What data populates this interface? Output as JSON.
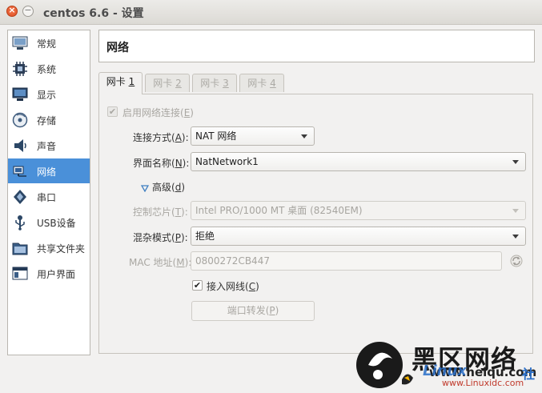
{
  "window": {
    "title": "centos 6.6 - 设置",
    "close_glyph": "×",
    "min_glyph": "−"
  },
  "sidebar": {
    "items": [
      {
        "label": "常规",
        "icon": "general-icon"
      },
      {
        "label": "系统",
        "icon": "chip-icon"
      },
      {
        "label": "显示",
        "icon": "monitor-icon"
      },
      {
        "label": "存储",
        "icon": "disk-icon"
      },
      {
        "label": "声音",
        "icon": "speaker-icon"
      },
      {
        "label": "网络",
        "icon": "network-icon",
        "selected": true
      },
      {
        "label": "串口",
        "icon": "serial-port-icon"
      },
      {
        "label": "USB设备",
        "icon": "usb-icon"
      },
      {
        "label": "共享文件夹",
        "icon": "folder-icon"
      },
      {
        "label": "用户界面",
        "icon": "window-icon"
      }
    ]
  },
  "header": {
    "title": "网络"
  },
  "tabs": [
    {
      "label": "网卡 ",
      "key": "1",
      "active": true
    },
    {
      "label": "网卡 ",
      "key": "2",
      "disabled": true
    },
    {
      "label": "网卡 ",
      "key": "3",
      "disabled": true
    },
    {
      "label": "网卡 ",
      "key": "4",
      "disabled": true
    }
  ],
  "adapter": {
    "enable_label": "启用网络连接(",
    "enable_key": "E",
    "enable_suffix": ")",
    "enable_checked": "✔",
    "attached_label": "连接方式(",
    "attached_key": "A",
    "attached_suffix": "):",
    "attached_value": "NAT 网络",
    "name_label": "界面名称(",
    "name_key": "N",
    "name_suffix": "):",
    "name_value": "NatNetwork1",
    "advanced_label": "高级(",
    "advanced_key": "d",
    "advanced_suffix": ")",
    "adapter_type_label": "控制芯片(",
    "adapter_type_key": "T",
    "adapter_type_suffix": "):",
    "adapter_type_value": "Intel PRO/1000 MT 桌面 (82540EM)",
    "promisc_label": "混杂模式(",
    "promisc_key": "P",
    "promisc_suffix": "):",
    "promisc_value": "拒绝",
    "mac_label": "MAC 地址(",
    "mac_key": "M",
    "mac_suffix": "):",
    "mac_value": "0800272CB447",
    "cable_label": "接入网线(",
    "cable_key": "C",
    "cable_suffix": ")",
    "cable_checked": "✔",
    "port_forward_label": "端口转发(",
    "port_forward_key": "P",
    "port_forward_suffix": ")"
  },
  "watermark": {
    "brand": "黑区网络",
    "site": "www.heiqu.com",
    "sub": "Linux",
    "sub2": "www.Linuxidc.com",
    "suffix": "社"
  }
}
